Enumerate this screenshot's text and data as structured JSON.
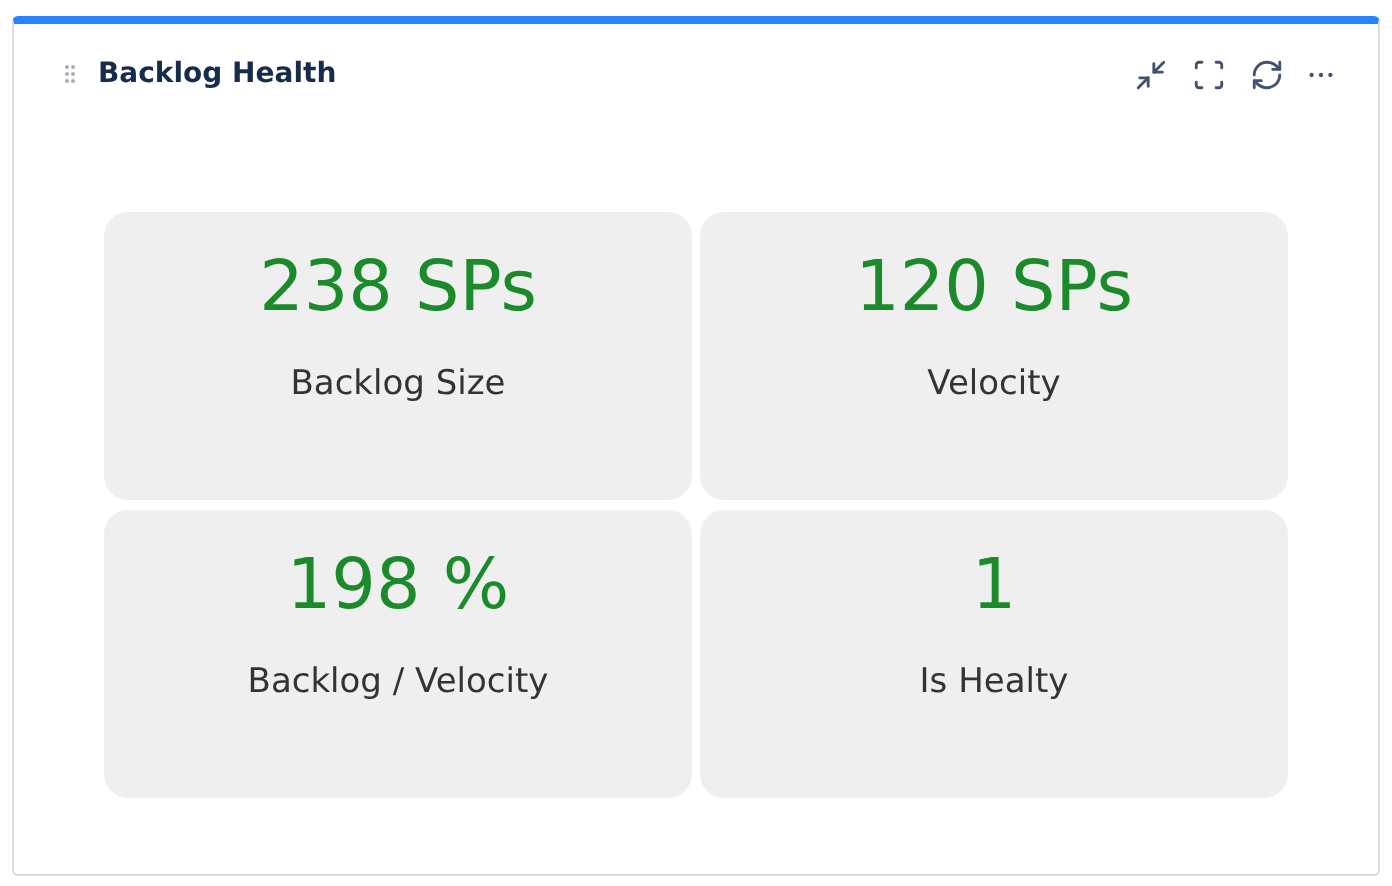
{
  "widget": {
    "title": "Backlog Health"
  },
  "metrics": [
    {
      "value": "238 SPs",
      "label": "Backlog Size"
    },
    {
      "value": "120 SPs",
      "label": "Velocity"
    },
    {
      "value": "198 %",
      "label": "Backlog / Velocity"
    },
    {
      "value": "1",
      "label": "Is Healty"
    }
  ]
}
